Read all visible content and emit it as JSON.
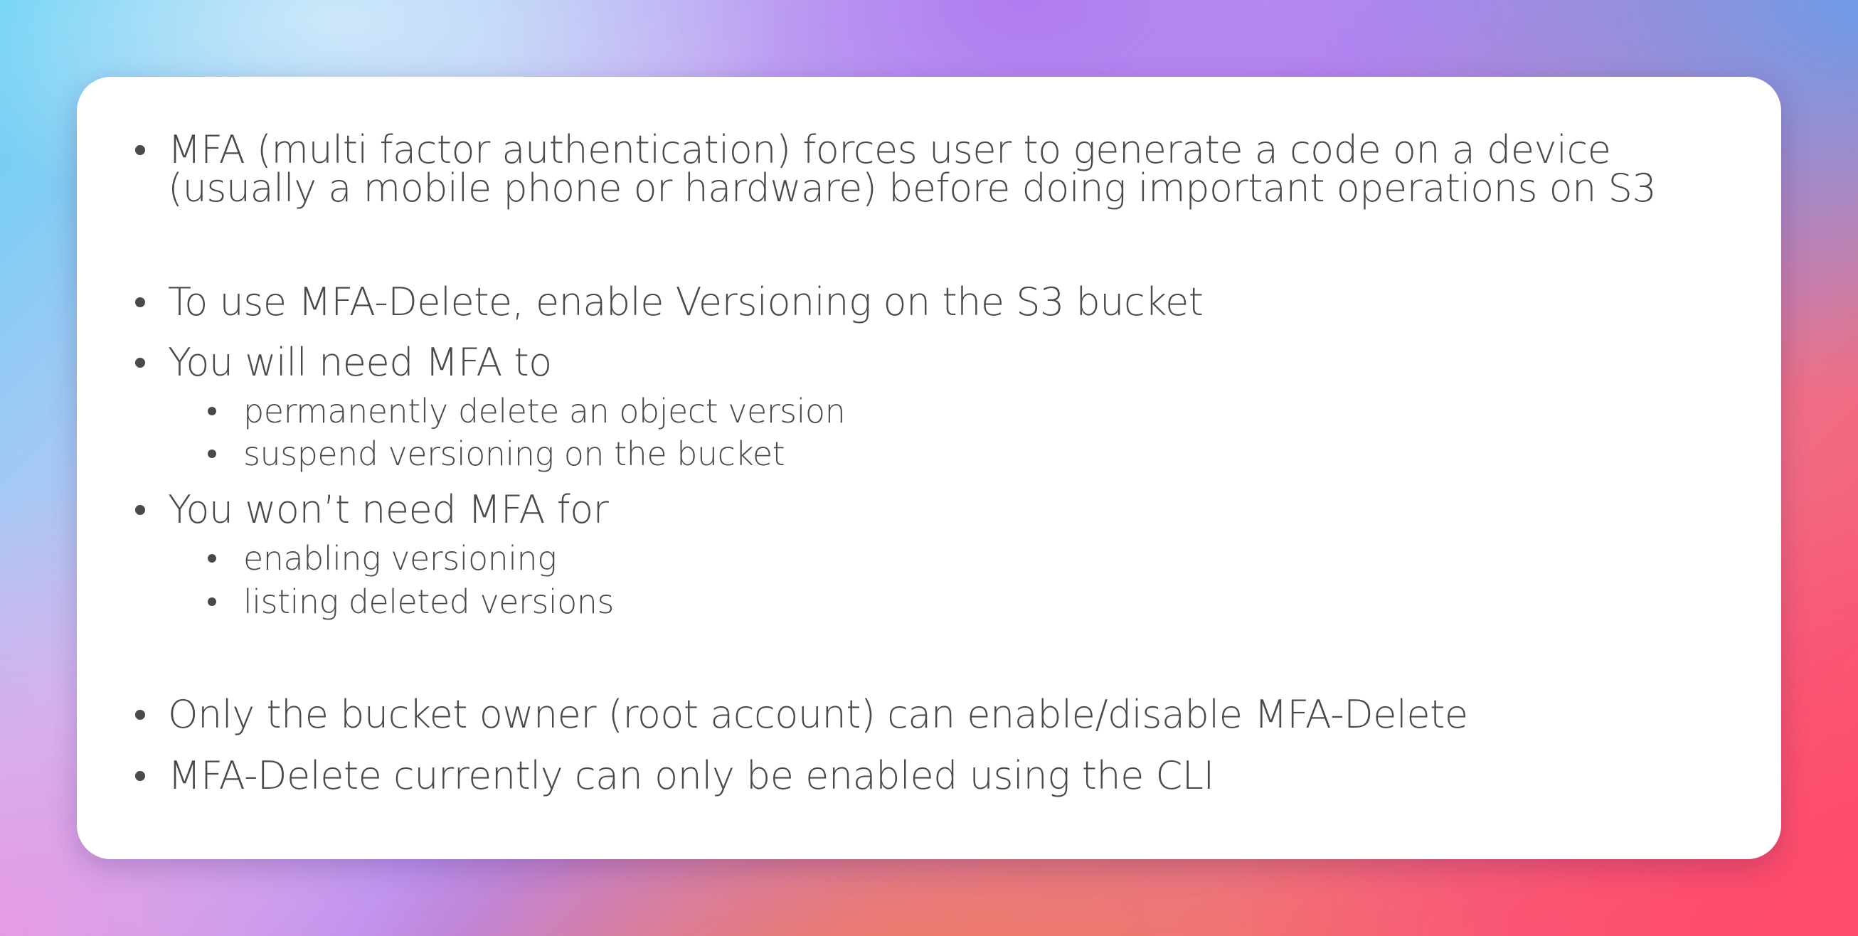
{
  "slide": {
    "bullets": [
      {
        "level": 1,
        "text": "MFA (multi factor authentication) forces user to generate a code on a device (usually a mobile phone or hardware) before doing important operations on S3"
      },
      {
        "level": 1,
        "text": "To use MFA-Delete, enable Versioning on the S3 bucket"
      },
      {
        "level": 1,
        "text": "You will need MFA to"
      },
      {
        "level": 2,
        "text": "permanently delete an object version"
      },
      {
        "level": 2,
        "text": "suspend versioning on the bucket"
      },
      {
        "level": 1,
        "text": "You won’t need MFA for"
      },
      {
        "level": 2,
        "text": "enabling versioning"
      },
      {
        "level": 2,
        "text": "listing deleted versions"
      },
      {
        "level": 1,
        "text": "Only the bucket owner (root account) can enable/disable MFA-Delete"
      },
      {
        "level": 1,
        "text": "MFA-Delete currently can only be enabled using the CLI"
      }
    ]
  }
}
